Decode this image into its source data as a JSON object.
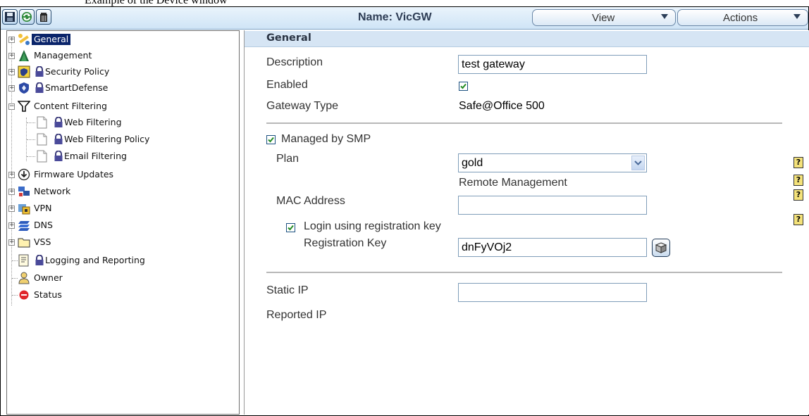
{
  "caption": "Example of the Device window",
  "toolbar": {
    "name_label": "Name: VicGW",
    "view_label": "View",
    "actions_label": "Actions",
    "buttons": [
      {
        "icon": "save-icon"
      },
      {
        "icon": "refresh-icon"
      },
      {
        "icon": "trash-icon"
      }
    ]
  },
  "tree": {
    "items": [
      {
        "label": "General",
        "icon": "wrench-icon",
        "selected": true
      },
      {
        "label": "Management",
        "icon": "antenna-icon"
      },
      {
        "label": "Security Policy",
        "icon": "policy-icon",
        "locked": true
      },
      {
        "label": "SmartDefense",
        "icon": "shield-icon",
        "locked": true
      },
      {
        "label": "Content Filtering",
        "icon": "filter-icon"
      },
      {
        "label": "Web Filtering",
        "icon": "page-icon",
        "locked": true
      },
      {
        "label": "Web Filtering Policy",
        "icon": "page-icon",
        "locked": true
      },
      {
        "label": "Email Filtering",
        "icon": "page-icon",
        "locked": true
      },
      {
        "label": "Firmware Updates",
        "icon": "download-icon"
      },
      {
        "label": "Network",
        "icon": "network-icon"
      },
      {
        "label": "VPN",
        "icon": "vpn-icon"
      },
      {
        "label": "DNS",
        "icon": "dns-icon"
      },
      {
        "label": "VSS",
        "icon": "folder-icon"
      },
      {
        "label": "Logging and Reporting",
        "icon": "log-icon",
        "locked": true
      },
      {
        "label": "Owner",
        "icon": "user-icon"
      },
      {
        "label": "Status",
        "icon": "status-icon"
      }
    ]
  },
  "form": {
    "section_title": "General",
    "description_label": "Description",
    "description_value": "test gateway",
    "enabled_label": "Enabled",
    "enabled_checked": true,
    "gateway_type_label": "Gateway Type",
    "gateway_type_value": "Safe@Office 500",
    "managed_label": "Managed by SMP",
    "managed_checked": true,
    "plan_label": "Plan",
    "plan_value": "gold",
    "plan_note": "Remote Management",
    "mac_label": "MAC Address",
    "mac_value": "",
    "login_label": "Login using registration key",
    "login_checked": true,
    "regkey_label": "Registration Key",
    "regkey_value": "dnFyVOj2",
    "static_ip_label": "Static IP",
    "static_ip_value": "",
    "reported_ip_label": "Reported IP",
    "help_text": "?"
  }
}
